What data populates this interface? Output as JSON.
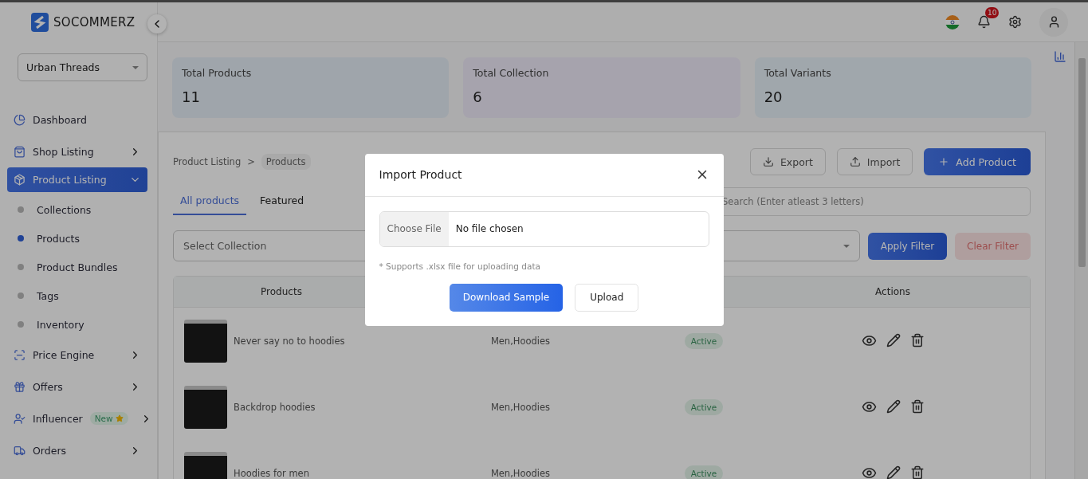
{
  "brand": {
    "name": "SOCOMMERZ"
  },
  "store_select": {
    "value": "Urban Threads"
  },
  "sidebar": {
    "items": [
      {
        "label": "Dashboard",
        "kind": "link",
        "selected": false
      },
      {
        "label": "Shop Listing",
        "kind": "group",
        "selected": false,
        "expanded": false
      },
      {
        "label": "Product Listing",
        "kind": "group",
        "selected": true,
        "expanded": true,
        "children": [
          {
            "label": "Collections",
            "selected": false
          },
          {
            "label": "Products",
            "selected": true
          },
          {
            "label": "Product Bundles",
            "selected": false
          },
          {
            "label": "Tags",
            "selected": false
          },
          {
            "label": "Inventory",
            "selected": false
          }
        ]
      },
      {
        "label": "Price Engine",
        "kind": "group",
        "selected": false,
        "expanded": false
      },
      {
        "label": "Offers",
        "kind": "group",
        "selected": false,
        "expanded": false
      },
      {
        "label": "Influencer",
        "kind": "group",
        "selected": false,
        "expanded": false,
        "badge": "New"
      },
      {
        "label": "Orders",
        "kind": "group",
        "selected": false,
        "expanded": false
      }
    ]
  },
  "header": {
    "notification_count": "10"
  },
  "stats": [
    {
      "label": "Total Products",
      "value": "11"
    },
    {
      "label": "Total Collection",
      "value": "6"
    },
    {
      "label": "Total Variants",
      "value": "20"
    }
  ],
  "breadcrumb": {
    "items": [
      {
        "label": "Product Listing"
      },
      {
        "label": "Products"
      }
    ],
    "separator": ">"
  },
  "tabs": [
    {
      "label": "All products",
      "selected": true
    },
    {
      "label": "Featured",
      "selected": false
    }
  ],
  "toolbar": [
    {
      "label": "Export",
      "kind": "export"
    },
    {
      "label": "Import",
      "kind": "import"
    },
    {
      "label": "Add Product",
      "kind": "primary"
    }
  ],
  "search": {
    "placeholder": "Search (Enter atleast 3 letters)"
  },
  "filters": {
    "collection_placeholder": "Select Collection",
    "apply": "Apply Filter",
    "clear": "Clear Filter"
  },
  "table": {
    "columns": [
      {
        "label": "Products"
      },
      {
        "label": "Actions"
      }
    ],
    "rows": [
      {
        "name": "Never say no to hoodies",
        "categories": "Men,Hoodies",
        "status": "Active"
      },
      {
        "name": "Backdrop hoodies",
        "categories": "Men,Hoodies",
        "status": "Active"
      },
      {
        "name": "Hoodies for men",
        "categories": "Men,Hoodies",
        "status": "Active"
      }
    ]
  },
  "modal": {
    "title": "Import Product",
    "file_button": "Choose File",
    "file_status": "No file chosen",
    "hint": "* Supports .xlsx file for uploading data",
    "buttons": [
      {
        "label": "Download Sample",
        "kind": "primary"
      },
      {
        "label": "Upload",
        "kind": "secondary"
      }
    ]
  }
}
